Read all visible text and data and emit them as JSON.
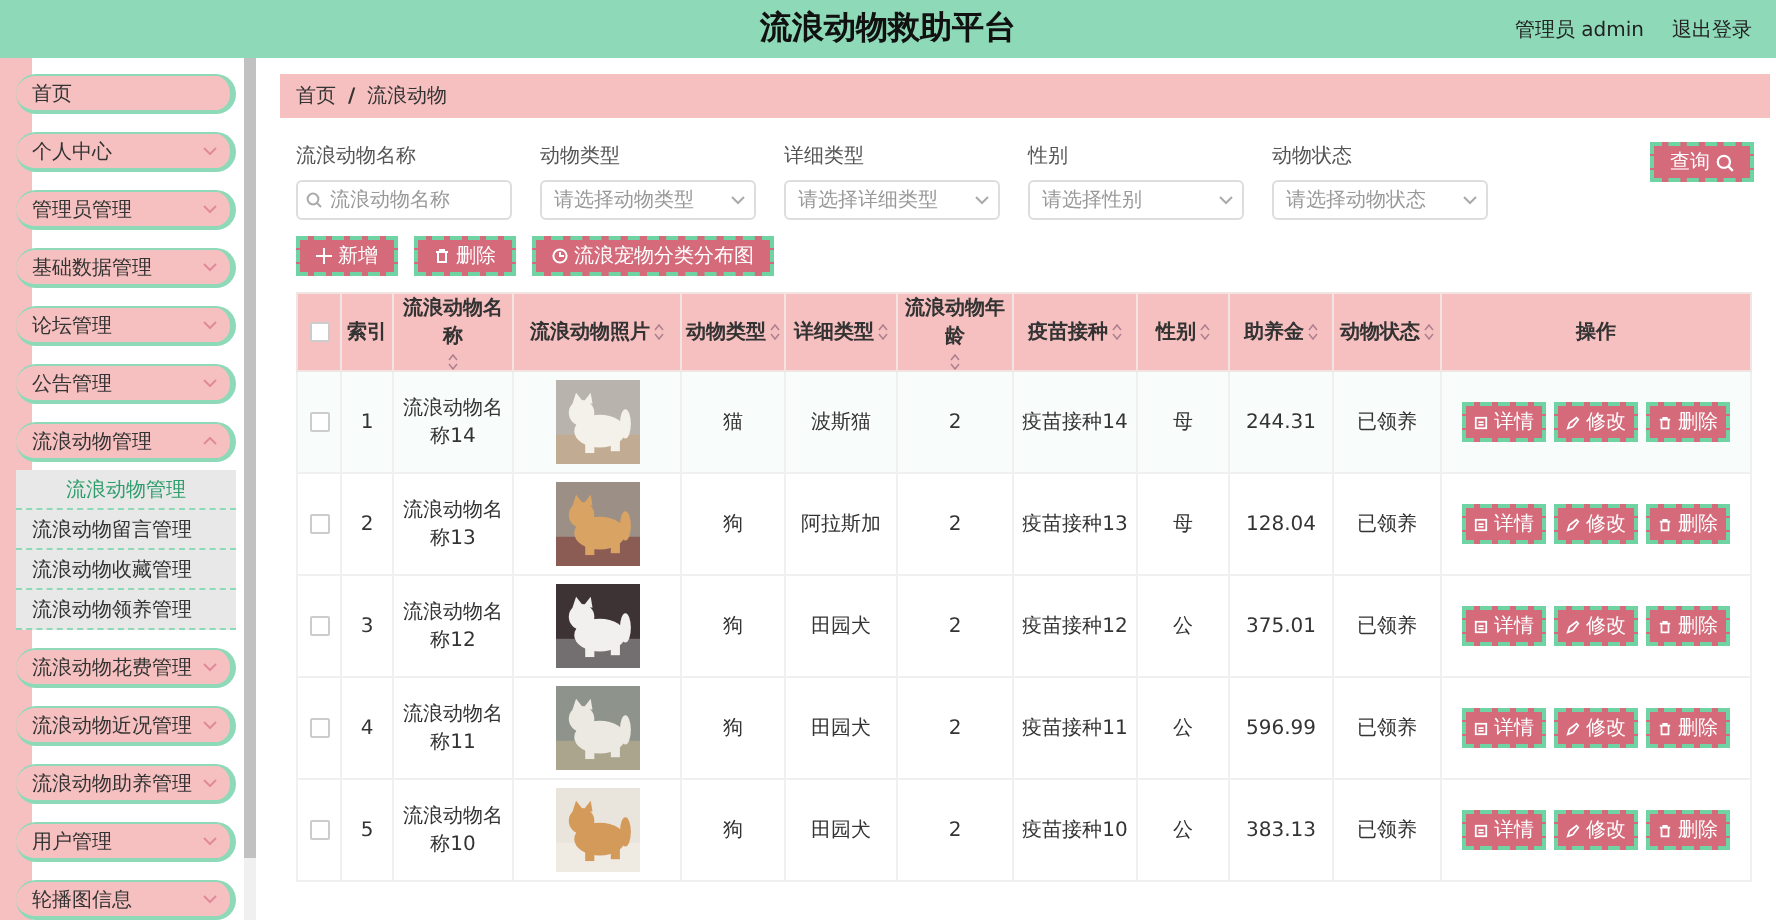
{
  "header": {
    "title": "流浪动物救助平台",
    "user": "管理员 admin",
    "logout": "退出登录"
  },
  "sidebar": {
    "items": [
      {
        "label": "首页",
        "kind": "link"
      },
      {
        "label": "个人中心",
        "kind": "menu",
        "expanded": false
      },
      {
        "label": "管理员管理",
        "kind": "menu",
        "expanded": false
      },
      {
        "label": "基础数据管理",
        "kind": "menu",
        "expanded": false
      },
      {
        "label": "论坛管理",
        "kind": "menu",
        "expanded": false
      },
      {
        "label": "公告管理",
        "kind": "menu",
        "expanded": false
      },
      {
        "label": "流浪动物管理",
        "kind": "menu",
        "expanded": true,
        "children": [
          {
            "label": "流浪动物管理",
            "selected": true
          },
          {
            "label": "流浪动物留言管理",
            "selected": false
          },
          {
            "label": "流浪动物收藏管理",
            "selected": false
          },
          {
            "label": "流浪动物领养管理",
            "selected": false
          }
        ]
      },
      {
        "label": "流浪动物花费管理",
        "kind": "menu",
        "expanded": false
      },
      {
        "label": "流浪动物近况管理",
        "kind": "menu",
        "expanded": false
      },
      {
        "label": "流浪动物助养管理",
        "kind": "menu",
        "expanded": false
      },
      {
        "label": "用户管理",
        "kind": "menu",
        "expanded": false
      },
      {
        "label": "轮播图信息",
        "kind": "menu",
        "expanded": false
      }
    ]
  },
  "breadcrumb": [
    "首页",
    "流浪动物"
  ],
  "breadcrumb_separator": "/",
  "filters": [
    {
      "label": "流浪动物名称",
      "placeholder": "流浪动物名称",
      "kind": "search"
    },
    {
      "label": "动物类型",
      "placeholder": "请选择动物类型",
      "kind": "select"
    },
    {
      "label": "详细类型",
      "placeholder": "请选择详细类型",
      "kind": "select"
    },
    {
      "label": "性别",
      "placeholder": "请选择性别",
      "kind": "select"
    },
    {
      "label": "动物状态",
      "placeholder": "请选择动物状态",
      "kind": "select"
    }
  ],
  "search_button": "查询",
  "actions": [
    {
      "label": "新增",
      "kind": "add"
    },
    {
      "label": "删除",
      "kind": "delete"
    },
    {
      "label": "流浪宠物分类分布图",
      "kind": "chart"
    }
  ],
  "table": {
    "select_all_checked": false,
    "columns": [
      {
        "label": "索引",
        "sortable": false
      },
      {
        "label": "流浪动物名称",
        "sortable": true
      },
      {
        "label": "流浪动物照片",
        "sortable": true
      },
      {
        "label": "动物类型",
        "sortable": true
      },
      {
        "label": "详细类型",
        "sortable": true
      },
      {
        "label": "流浪动物年龄",
        "sortable": true
      },
      {
        "label": "疫苗接种",
        "sortable": true
      },
      {
        "label": "性别",
        "sortable": true
      },
      {
        "label": "助养金",
        "sortable": true
      },
      {
        "label": "动物状态",
        "sortable": true
      },
      {
        "label": "操作",
        "sortable": false
      }
    ],
    "rows": [
      {
        "checked": false,
        "index": "1",
        "name": "流浪动物名称14",
        "photo": {
          "kind": "picture"
        },
        "type": "猫",
        "detail": "波斯猫",
        "age": "2",
        "vaccine": "疫苗接种14",
        "gender": "母",
        "fund": "244.31",
        "status": "已领养",
        "actions": [
          "详情",
          "修改",
          "删除"
        ]
      },
      {
        "checked": false,
        "index": "2",
        "name": "流浪动物名称13",
        "photo": {
          "kind": "picture"
        },
        "type": "狗",
        "detail": "阿拉斯加",
        "age": "2",
        "vaccine": "疫苗接种13",
        "gender": "母",
        "fund": "128.04",
        "status": "已领养",
        "actions": [
          "详情",
          "修改",
          "删除"
        ]
      },
      {
        "checked": false,
        "index": "3",
        "name": "流浪动物名称12",
        "photo": {
          "kind": "picture"
        },
        "type": "狗",
        "detail": "田园犬",
        "age": "2",
        "vaccine": "疫苗接种12",
        "gender": "公",
        "fund": "375.01",
        "status": "已领养",
        "actions": [
          "详情",
          "修改",
          "删除"
        ]
      },
      {
        "checked": false,
        "index": "4",
        "name": "流浪动物名称11",
        "photo": {
          "kind": "picture"
        },
        "type": "狗",
        "detail": "田园犬",
        "age": "2",
        "vaccine": "疫苗接种11",
        "gender": "公",
        "fund": "596.99",
        "status": "已领养",
        "actions": [
          "详情",
          "修改",
          "删除"
        ]
      },
      {
        "checked": false,
        "index": "5",
        "name": "流浪动物名称10",
        "photo": {
          "kind": "picture"
        },
        "type": "狗",
        "detail": "田园犬",
        "age": "2",
        "vaccine": "疫苗接种10",
        "gender": "公",
        "fund": "383.13",
        "status": "已领养",
        "actions": [
          "详情",
          "修改",
          "删除"
        ]
      }
    ]
  }
}
